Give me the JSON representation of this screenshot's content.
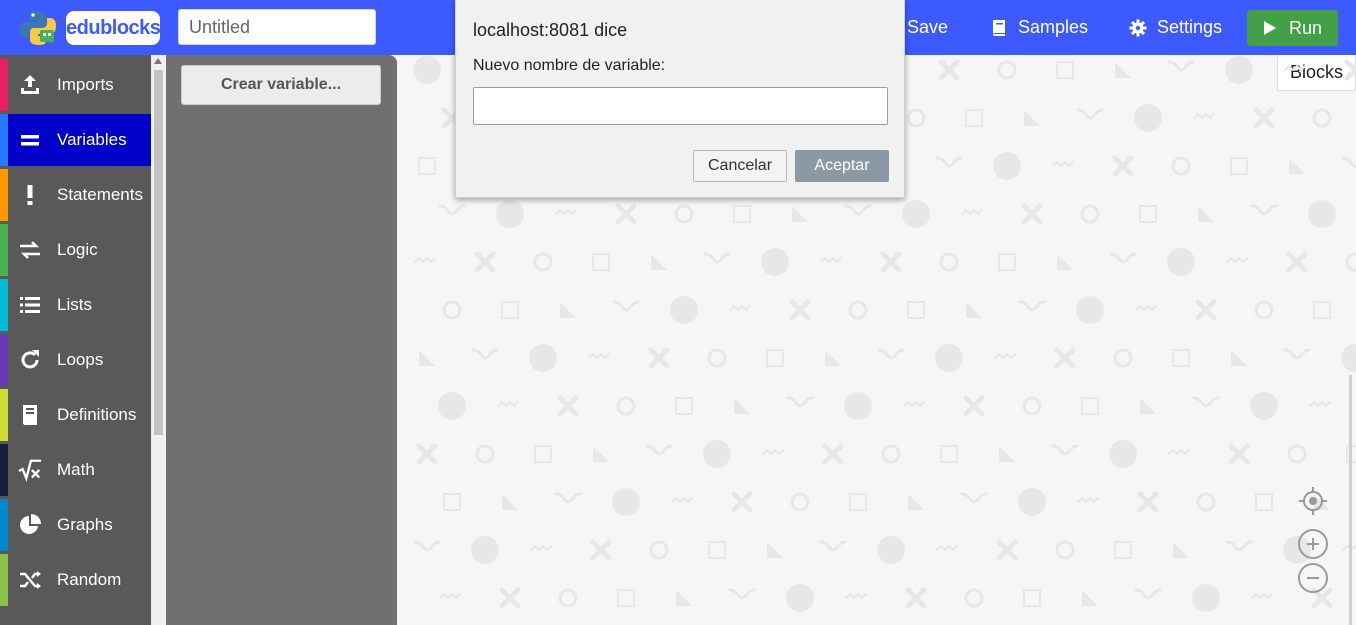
{
  "header": {
    "brand": {
      "part1": "edu",
      "part2": "blocks"
    },
    "title_placeholder": "Untitled",
    "save_label": "Save",
    "samples_label": "Samples",
    "settings_label": "Settings",
    "run_label": "Run",
    "colors": {
      "bar": "#3d5afe",
      "run": "#43a047"
    }
  },
  "view_tab": "Blocks",
  "sidebar": {
    "items": [
      {
        "label": "Imports",
        "color": "#e91e63",
        "icon": "upload-icon"
      },
      {
        "label": "Variables",
        "color": "#2979ff",
        "icon": "equals-icon",
        "selected": true
      },
      {
        "label": "Statements",
        "color": "#ff9800",
        "icon": "exclamation-icon"
      },
      {
        "label": "Logic",
        "color": "#4caf50",
        "icon": "swap-arrows-icon"
      },
      {
        "label": "Lists",
        "color": "#00bcd4",
        "icon": "list-icon"
      },
      {
        "label": "Loops",
        "color": "#673ab7",
        "icon": "loop-icon"
      },
      {
        "label": "Definitions",
        "color": "#cddc39",
        "icon": "book-icon"
      },
      {
        "label": "Math",
        "color": "#1a1a3a",
        "icon": "sqrt-icon"
      },
      {
        "label": "Graphs",
        "color": "#0288d1",
        "icon": "pie-chart-icon"
      },
      {
        "label": "Random",
        "color": "#8bc34a",
        "icon": "shuffle-icon"
      }
    ]
  },
  "flyout": {
    "create_variable_label": "Crear variable..."
  },
  "dialog": {
    "title": "localhost:8081 dice",
    "message": "Nuevo nombre de variable:",
    "input_value": "",
    "cancel_label": "Cancelar",
    "ok_label": "Aceptar"
  }
}
